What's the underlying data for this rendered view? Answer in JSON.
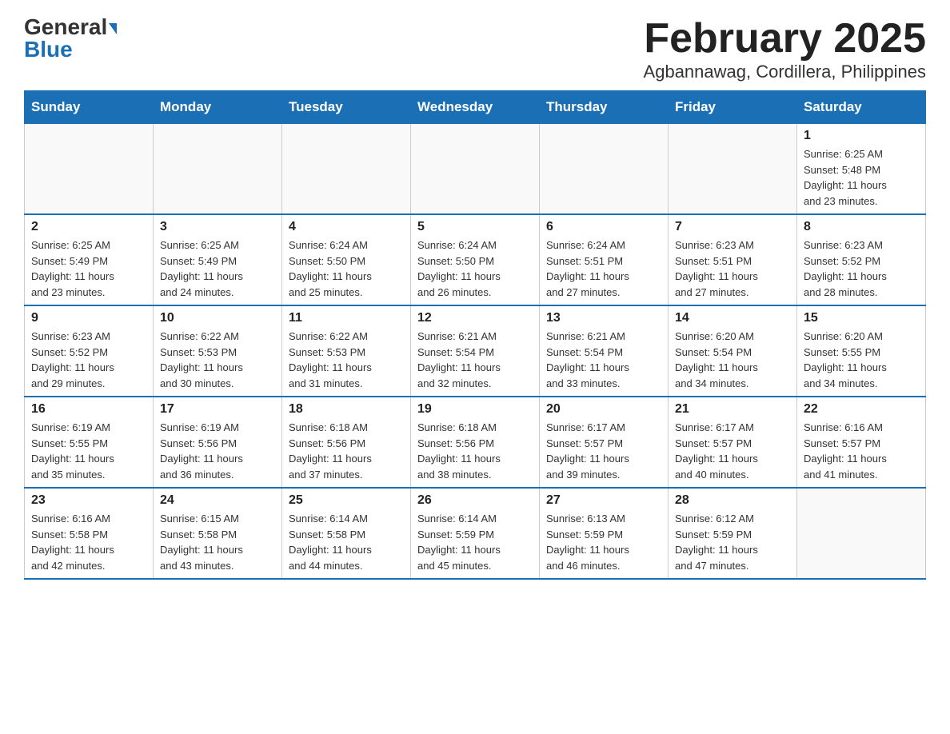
{
  "logo": {
    "line1": "General",
    "line2": "Blue"
  },
  "title": "February 2025",
  "subtitle": "Agbannawag, Cordillera, Philippines",
  "days_header": [
    "Sunday",
    "Monday",
    "Tuesday",
    "Wednesday",
    "Thursday",
    "Friday",
    "Saturday"
  ],
  "weeks": [
    [
      {
        "day": "",
        "info": ""
      },
      {
        "day": "",
        "info": ""
      },
      {
        "day": "",
        "info": ""
      },
      {
        "day": "",
        "info": ""
      },
      {
        "day": "",
        "info": ""
      },
      {
        "day": "",
        "info": ""
      },
      {
        "day": "1",
        "info": "Sunrise: 6:25 AM\nSunset: 5:48 PM\nDaylight: 11 hours\nand 23 minutes."
      }
    ],
    [
      {
        "day": "2",
        "info": "Sunrise: 6:25 AM\nSunset: 5:49 PM\nDaylight: 11 hours\nand 23 minutes."
      },
      {
        "day": "3",
        "info": "Sunrise: 6:25 AM\nSunset: 5:49 PM\nDaylight: 11 hours\nand 24 minutes."
      },
      {
        "day": "4",
        "info": "Sunrise: 6:24 AM\nSunset: 5:50 PM\nDaylight: 11 hours\nand 25 minutes."
      },
      {
        "day": "5",
        "info": "Sunrise: 6:24 AM\nSunset: 5:50 PM\nDaylight: 11 hours\nand 26 minutes."
      },
      {
        "day": "6",
        "info": "Sunrise: 6:24 AM\nSunset: 5:51 PM\nDaylight: 11 hours\nand 27 minutes."
      },
      {
        "day": "7",
        "info": "Sunrise: 6:23 AM\nSunset: 5:51 PM\nDaylight: 11 hours\nand 27 minutes."
      },
      {
        "day": "8",
        "info": "Sunrise: 6:23 AM\nSunset: 5:52 PM\nDaylight: 11 hours\nand 28 minutes."
      }
    ],
    [
      {
        "day": "9",
        "info": "Sunrise: 6:23 AM\nSunset: 5:52 PM\nDaylight: 11 hours\nand 29 minutes."
      },
      {
        "day": "10",
        "info": "Sunrise: 6:22 AM\nSunset: 5:53 PM\nDaylight: 11 hours\nand 30 minutes."
      },
      {
        "day": "11",
        "info": "Sunrise: 6:22 AM\nSunset: 5:53 PM\nDaylight: 11 hours\nand 31 minutes."
      },
      {
        "day": "12",
        "info": "Sunrise: 6:21 AM\nSunset: 5:54 PM\nDaylight: 11 hours\nand 32 minutes."
      },
      {
        "day": "13",
        "info": "Sunrise: 6:21 AM\nSunset: 5:54 PM\nDaylight: 11 hours\nand 33 minutes."
      },
      {
        "day": "14",
        "info": "Sunrise: 6:20 AM\nSunset: 5:54 PM\nDaylight: 11 hours\nand 34 minutes."
      },
      {
        "day": "15",
        "info": "Sunrise: 6:20 AM\nSunset: 5:55 PM\nDaylight: 11 hours\nand 34 minutes."
      }
    ],
    [
      {
        "day": "16",
        "info": "Sunrise: 6:19 AM\nSunset: 5:55 PM\nDaylight: 11 hours\nand 35 minutes."
      },
      {
        "day": "17",
        "info": "Sunrise: 6:19 AM\nSunset: 5:56 PM\nDaylight: 11 hours\nand 36 minutes."
      },
      {
        "day": "18",
        "info": "Sunrise: 6:18 AM\nSunset: 5:56 PM\nDaylight: 11 hours\nand 37 minutes."
      },
      {
        "day": "19",
        "info": "Sunrise: 6:18 AM\nSunset: 5:56 PM\nDaylight: 11 hours\nand 38 minutes."
      },
      {
        "day": "20",
        "info": "Sunrise: 6:17 AM\nSunset: 5:57 PM\nDaylight: 11 hours\nand 39 minutes."
      },
      {
        "day": "21",
        "info": "Sunrise: 6:17 AM\nSunset: 5:57 PM\nDaylight: 11 hours\nand 40 minutes."
      },
      {
        "day": "22",
        "info": "Sunrise: 6:16 AM\nSunset: 5:57 PM\nDaylight: 11 hours\nand 41 minutes."
      }
    ],
    [
      {
        "day": "23",
        "info": "Sunrise: 6:16 AM\nSunset: 5:58 PM\nDaylight: 11 hours\nand 42 minutes."
      },
      {
        "day": "24",
        "info": "Sunrise: 6:15 AM\nSunset: 5:58 PM\nDaylight: 11 hours\nand 43 minutes."
      },
      {
        "day": "25",
        "info": "Sunrise: 6:14 AM\nSunset: 5:58 PM\nDaylight: 11 hours\nand 44 minutes."
      },
      {
        "day": "26",
        "info": "Sunrise: 6:14 AM\nSunset: 5:59 PM\nDaylight: 11 hours\nand 45 minutes."
      },
      {
        "day": "27",
        "info": "Sunrise: 6:13 AM\nSunset: 5:59 PM\nDaylight: 11 hours\nand 46 minutes."
      },
      {
        "day": "28",
        "info": "Sunrise: 6:12 AM\nSunset: 5:59 PM\nDaylight: 11 hours\nand 47 minutes."
      },
      {
        "day": "",
        "info": ""
      }
    ]
  ]
}
